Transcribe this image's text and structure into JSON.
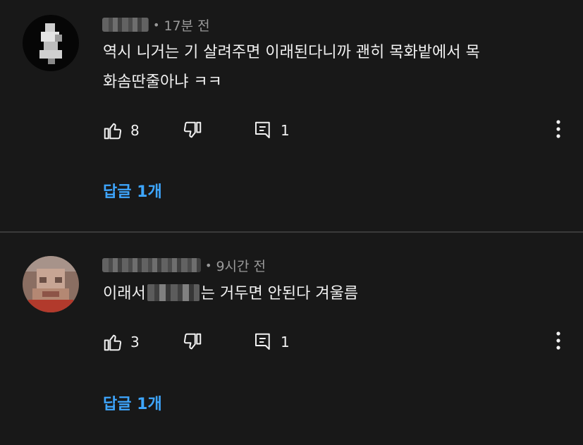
{
  "comments": [
    {
      "time": "17분 전",
      "text_line1": "역시 니거는 기 살려주면 이래된다니까 괜히 목화밭에서 목",
      "text_line2": "화솜딴줄아냐 ㅋㅋ",
      "likes": "8",
      "reply_count": "1",
      "replies_label": "답글 1개"
    },
    {
      "time": "9시간 전",
      "text_before": "이래서",
      "text_after": "는 거두면 안된다 겨울름",
      "likes": "3",
      "reply_count": "1",
      "replies_label": "답글 1개"
    }
  ],
  "meta_dot": "•",
  "colors": {
    "background": "#181818",
    "link": "#3ea6ff",
    "meta": "#9a9a9a",
    "divider": "#3a3a3a"
  },
  "icons": [
    "thumbs-up-icon",
    "thumbs-down-icon",
    "reply-icon",
    "more-vert-icon"
  ]
}
